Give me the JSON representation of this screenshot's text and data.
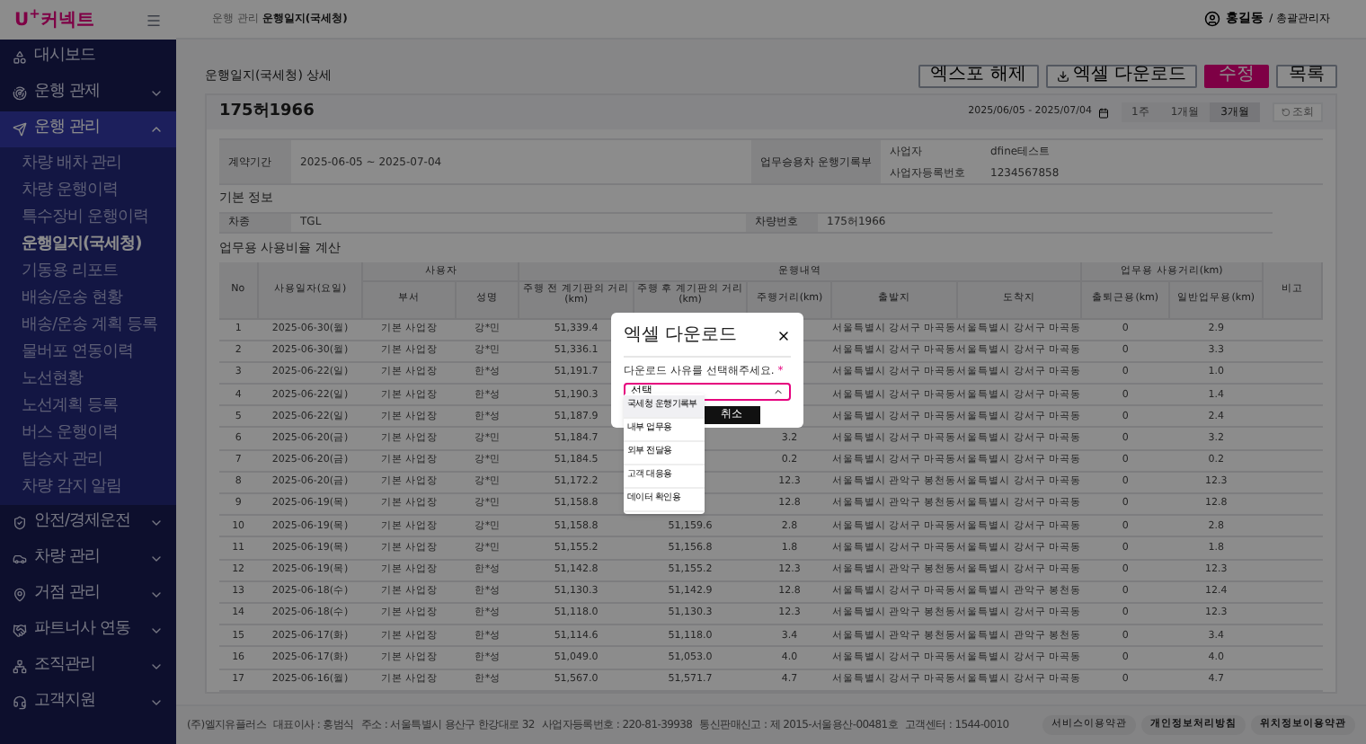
{
  "sidebar": {
    "logo": "U$^{+}$커넥트",
    "items": [
      {
        "label": "대시보드"
      },
      {
        "label": "운행 관제",
        "expanded": false
      },
      {
        "label": "운행 관리",
        "expanded": true,
        "children": [
          {
            "label": "차량 배차 관리",
            "selected": false
          },
          {
            "label": "차량 운행이력",
            "selected": false
          },
          {
            "label": "특수장비 운행이력",
            "selected": false
          },
          {
            "label": "운행일지(국세청)",
            "selected": true
          },
          {
            "label": "기동용 리포트",
            "selected": false
          },
          {
            "label": "배송/운송 현황",
            "selected": false
          },
          {
            "label": "배송/운송 계획 등록",
            "selected": false
          },
          {
            "label": "물버포 연동이력",
            "selected": false
          },
          {
            "label": "노선현황",
            "selected": false
          },
          {
            "label": "노선계획 등록",
            "selected": false
          },
          {
            "label": "버스 운행이력",
            "selected": false
          },
          {
            "label": "탑승자 관리",
            "selected": false
          },
          {
            "label": "차량 감지 알림",
            "selected": false
          }
        ]
      },
      {
        "label": "안전/경제운전",
        "expanded": false
      },
      {
        "label": "차량 관리",
        "expanded": false
      },
      {
        "label": "거점 관리",
        "expanded": false
      },
      {
        "label": "파트너사 연동",
        "expanded": false
      },
      {
        "label": "조직관리",
        "expanded": false
      },
      {
        "label": "고객지원",
        "expanded": false
      }
    ]
  },
  "header": {
    "breadcrumb": [
      "운행 관리",
      "운행일지(국세청)"
    ],
    "user_name": "홍길동",
    "user_role": "/ 총괄관리자"
  },
  "page": {
    "title": "운행일지(국세청) 상세",
    "buttons": [
      {
        "label": "엑스포 해제",
        "kind": "outline"
      },
      {
        "label": "엑셀 다운로드",
        "kind": "download"
      },
      {
        "label": "수정",
        "kind": "primary"
      },
      {
        "label": "목록",
        "kind": "outline"
      }
    ]
  },
  "vehicle": {
    "number": "175허1966",
    "date_range": "2025/06/05 - 2025/07/04",
    "periods": [
      {
        "label": "1주",
        "selected": false
      },
      {
        "label": "1개월",
        "selected": false
      },
      {
        "label": "3개월",
        "selected": true
      }
    ],
    "search_button": "조회"
  },
  "contract": {
    "label": "계약기간",
    "value": "2025-06-05 ~ 2025-07-04",
    "group_label": "업무승용차 운행기록부",
    "fields": [
      {
        "label": "사업자",
        "value": "dfine테스트"
      },
      {
        "label": "사업자등록번호",
        "value": "1234567858"
      }
    ]
  },
  "basic_info": {
    "title": "기본 정보",
    "fields": [
      {
        "label": "차종",
        "value": "TGL"
      },
      {
        "label": "차량번호",
        "value": "175허1966"
      }
    ]
  },
  "usage_table": {
    "title": "업무용 사용비율 계산",
    "headers": {
      "no": "No",
      "date": "사용일자(요일)",
      "user_group": "사용자",
      "dept": "부서",
      "name": "성명",
      "trip_group": "운행내역",
      "odo_before": "주행 전 계기판의 거리(km)",
      "odo_after": "주행 후 계기판의 거리(km)",
      "distance": "주행거리(km)",
      "origin": "출발지",
      "destination": "도착지",
      "business_group": "업무용 사용거리(km)",
      "commute": "출퇴근용(km)",
      "general": "일반업무용(km)",
      "note": "비고"
    },
    "rows": [
      {
        "no": "1",
        "date": "2025-06-30(월)",
        "dept": "기본 사업장",
        "name": "강*민",
        "odo_before": "51,339.4",
        "origin": "서울특별시 강서구 마곡동",
        "destination": "서울특별시 강서구 마곡동",
        "commute": "0",
        "general": "2.9"
      },
      {
        "no": "2",
        "date": "2025-06-30(월)",
        "dept": "기본 사업장",
        "name": "강*민",
        "odo_before": "51,336.1",
        "origin": "서울특별시 강서구 마곡동",
        "destination": "서울특별시 강서구 마곡동",
        "commute": "0",
        "general": "3.3"
      },
      {
        "no": "3",
        "date": "2025-06-22(일)",
        "dept": "기본 사업장",
        "name": "한*성",
        "odo_before": "51,191.7",
        "origin": "서울특별시 강서구 마곡동",
        "destination": "서울특별시 강서구 마곡동",
        "commute": "0",
        "general": "1.0"
      },
      {
        "no": "4",
        "date": "2025-06-22(일)",
        "dept": "기본 사업장",
        "name": "한*성",
        "odo_before": "51,190.3",
        "origin": "서울특별시 강서구 마곡동",
        "destination": "서울특별시 강서구 마곡동",
        "commute": "0",
        "general": "1.4"
      },
      {
        "no": "5",
        "date": "2025-06-22(일)",
        "dept": "기본 사업장",
        "name": "한*성",
        "odo_before": "51,187.9",
        "origin": "서울특별시 강서구 마곡동",
        "destination": "서울특별시 강서구 마곡동",
        "commute": "0",
        "general": "2.4"
      },
      {
        "no": "6",
        "date": "2025-06-20(금)",
        "dept": "기본 사업장",
        "name": "강*민",
        "odo_before": "51,184.7",
        "distance": "3.2",
        "origin": "서울특별시 강서구 마곡동",
        "destination": "서울특별시 강서구 마곡동",
        "commute": "0",
        "general": "3.2"
      },
      {
        "no": "7",
        "date": "2025-06-20(금)",
        "dept": "기본 사업장",
        "name": "강*민",
        "odo_before": "51,184.5",
        "distance": "0.2",
        "origin": "서울특별시 강서구 마곡동",
        "destination": "서울특별시 강서구 마곡동",
        "commute": "0",
        "general": "0.2"
      },
      {
        "no": "8",
        "date": "2025-06-20(금)",
        "dept": "기본 사업장",
        "name": "강*민",
        "odo_before": "51,172.2",
        "distance": "12.3",
        "origin": "서울특별시 관악구 봉천동",
        "destination": "서울특별시 강서구 마곡동",
        "commute": "0",
        "general": "12.3"
      },
      {
        "no": "9",
        "date": "2025-06-19(목)",
        "dept": "기본 사업장",
        "name": "강*민",
        "odo_before": "51,158.8",
        "distance": "12.8",
        "origin": "서울특별시 관악구 봉천동",
        "destination": "서울특별시 강서구 마곡동",
        "commute": "0",
        "general": "12.8"
      },
      {
        "no": "10",
        "date": "2025-06-19(목)",
        "dept": "기본 사업장",
        "name": "강*민",
        "odo_before": "51,158.8",
        "odo_after": "51,159.6",
        "distance": "2.8",
        "origin": "서울특별시 강서구 마곡동",
        "destination": "서울특별시 강서구 마곡동",
        "commute": "0",
        "general": "2.8"
      },
      {
        "no": "11",
        "date": "2025-06-19(목)",
        "dept": "기본 사업장",
        "name": "강*민",
        "odo_before": "51,155.2",
        "odo_after": "51,156.8",
        "distance": "1.8",
        "origin": "서울특별시 강서구 마곡동",
        "destination": "서울특별시 강서구 마곡동",
        "commute": "0",
        "general": "1.8"
      },
      {
        "no": "12",
        "date": "2025-06-19(목)",
        "dept": "기본 사업장",
        "name": "한*성",
        "odo_before": "51,142.8",
        "odo_after": "51,155.2",
        "distance": "12.3",
        "origin": "서울특별시 관악구 봉천동",
        "destination": "서울특별시 강서구 마곡동",
        "commute": "0",
        "general": "12.3"
      },
      {
        "no": "13",
        "date": "2025-06-18(수)",
        "dept": "기본 사업장",
        "name": "한*성",
        "odo_before": "51,130.3",
        "odo_after": "51,142.9",
        "distance": "12.8",
        "origin": "서울특별시 강서구 마곡동",
        "destination": "서울특별시 관악구 봉천동",
        "commute": "0",
        "general": "12.4"
      },
      {
        "no": "14",
        "date": "2025-06-18(수)",
        "dept": "기본 사업장",
        "name": "한*성",
        "odo_before": "51,118.0",
        "odo_after": "51,130.3",
        "distance": "12.3",
        "origin": "서울특별시 관악구 봉천동",
        "destination": "서울특별시 강서구 마곡동",
        "commute": "0",
        "general": "12.3"
      },
      {
        "no": "15",
        "date": "2025-06-17(화)",
        "dept": "기본 사업장",
        "name": "한*성",
        "odo_before": "51,114.6",
        "odo_after": "51,118.0",
        "distance": "3.4",
        "origin": "서울특별시 관악구 봉천동",
        "destination": "서울특별시 관악구 봉천동",
        "commute": "0",
        "general": "3.4"
      },
      {
        "no": "16",
        "date": "2025-06-17(화)",
        "dept": "기본 사업장",
        "name": "한*성",
        "odo_before": "51,049.0",
        "odo_after": "51,053.0",
        "distance": "4.0",
        "origin": "서울특별시 강서구 마곡동",
        "destination": "서울특별시 강서구 마곡동",
        "commute": "0",
        "general": "4.0"
      },
      {
        "no": "17",
        "date": "2025-06-16(월)",
        "dept": "기본 사업장",
        "name": "한*성",
        "odo_before": "51,567.0",
        "odo_after": "51,571.7",
        "distance": "4.7",
        "origin": "서울특별시 강서구 마곡동",
        "destination": "서울특별시 강서구 마곡동",
        "commute": "0",
        "general": "4.7"
      }
    ]
  },
  "footer": {
    "company_info": [
      "(주)엘지유플러스",
      "대표이사 : 홍범식",
      "주소 : 서울특별시 용산구 한강대로 32",
      "사업자등록번호 : 220-81-39938",
      "통신판매신고 : 제 2015-서울용산-00481호",
      "고객센터 : 1544-0010"
    ],
    "links": [
      {
        "label": "서비스이용약관",
        "bold": false
      },
      {
        "label": "개인정보처리방침",
        "bold": true
      },
      {
        "label": "위치정보이용약관",
        "bold": true
      }
    ]
  },
  "modal": {
    "title": "엑셀 다운로드",
    "label": "다운로드 사유를 선택해주세요.",
    "required_mark": "*",
    "select_value": "선택",
    "expanded": true,
    "options": [
      {
        "label": "국세청 운행기록부",
        "selected": true
      },
      {
        "label": "내부 업무용",
        "selected": false
      },
      {
        "label": "외부 전달용",
        "selected": false
      },
      {
        "label": "고객 대응용",
        "selected": false
      },
      {
        "label": "데이터 확인용",
        "selected": false
      }
    ],
    "cancel_button": "취소"
  }
}
